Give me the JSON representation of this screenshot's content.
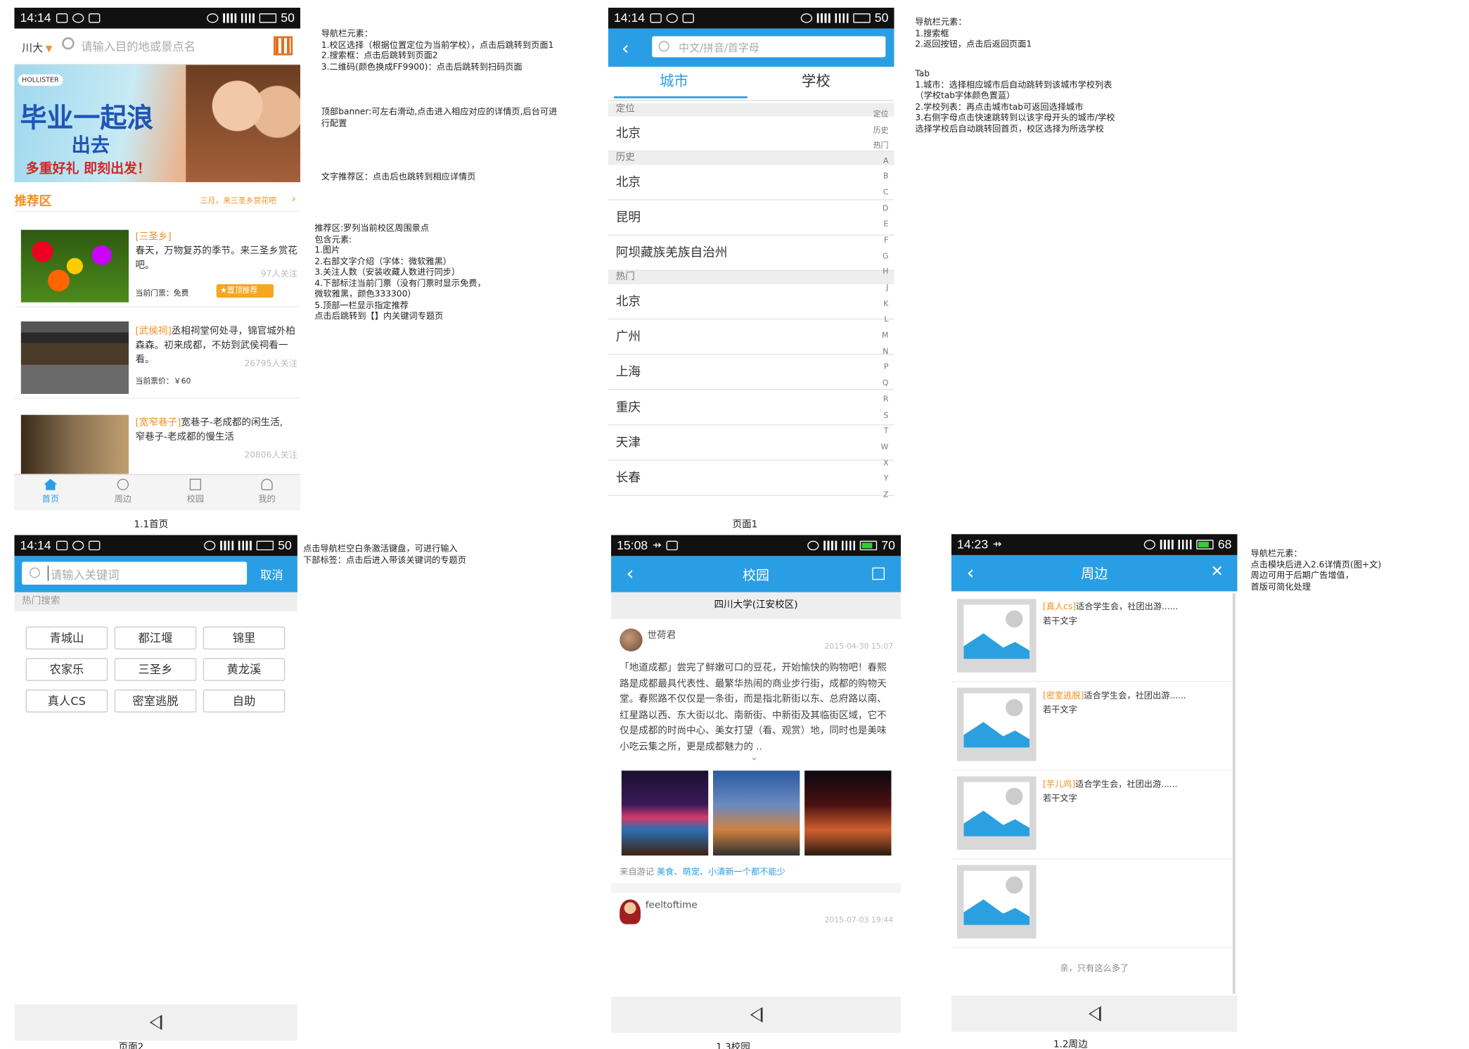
{
  "screens": {
    "home": {
      "status": {
        "time": "14:14",
        "battery": "50"
      },
      "location": "川大",
      "search_placeholder": "请输入目的地或景点名",
      "banner": {
        "brand": "HOLLISTER",
        "line1": "毕业一起浪",
        "line2": "出去",
        "line3": "多重好礼 即刻出发！"
      },
      "section_title": "推荐区",
      "section_more": "三月，来三圣乡赏花吧",
      "items": [
        {
          "tag": "[三圣乡]",
          "text": "春天，万物复苏的季节。来三圣乡赏花吧。",
          "followers": "97人关注",
          "price": "当前门票：免费",
          "badge": "置顶推荐"
        },
        {
          "tag": "[武侯祠]",
          "text": "丞相祠堂何处寻，锦官城外柏森森。初来成都，不妨到武侯祠看一看。",
          "followers": "26795人关注",
          "price": "当前票价：￥60"
        },
        {
          "tag": "[宽窄巷子]",
          "text": "宽巷子-老成都的闲生活, 窄巷子-老成都的慢生活",
          "followers": "20806人关注",
          "price": ""
        }
      ],
      "tabs": [
        "首页",
        "周边",
        "校园",
        "我的"
      ],
      "caption": "1.1首页"
    },
    "city": {
      "status": {
        "time": "14:14",
        "battery": "50"
      },
      "search_placeholder": "中文/拼音/首字母",
      "tabs": [
        "城市",
        "学校"
      ],
      "sections": [
        {
          "label": "定位",
          "rows": [
            "北京"
          ]
        },
        {
          "label": "历史",
          "rows": [
            "北京",
            "昆明",
            "阿坝藏族羌族自治州"
          ]
        },
        {
          "label": "热门",
          "rows": [
            "北京",
            "广州",
            "上海",
            "重庆",
            "天津",
            "长春"
          ]
        }
      ],
      "index": [
        "定位",
        "历史",
        "热门",
        "A",
        "B",
        "C",
        "D",
        "E",
        "F",
        "G",
        "H",
        "J",
        "K",
        "L",
        "M",
        "N",
        "P",
        "Q",
        "R",
        "S",
        "T",
        "W",
        "X",
        "Y",
        "Z"
      ],
      "caption": "页面1"
    },
    "search": {
      "status": {
        "time": "14:14",
        "battery": "50"
      },
      "placeholder": "请输入关键词",
      "cancel": "取消",
      "hot_title": "热门搜索",
      "chips": [
        "青城山",
        "都江堰",
        "锦里",
        "农家乐",
        "三圣乡",
        "黄龙溪",
        "真人CS",
        "密室逃脱",
        "自助"
      ],
      "caption": "页面2"
    },
    "campus": {
      "status": {
        "time": "15:08",
        "battery": "70"
      },
      "title": "校园",
      "school": "四川大学(江安校区)",
      "post1": {
        "user": "世荷君",
        "date": "2015-04-30 15:07",
        "body": "「地道成都」尝完了鲜嫩可口的豆花，开始愉快的购物吧！春熙路是成都最具代表性、最繁华热闹的商业步行街，成都的购物天堂。春熙路不仅仅是一条街，而是指北新街以东、总府路以南、红星路以西、东大街以北、南新街、中新街及其临街区域，它不仅是成都的时尚中心、美女打望（看、观赏）地，同时也是美味小吃云集之所，更是成都魅力的 ..",
        "source_prefix": "来自游记",
        "source_link": "美食、萌宠、小清新一个都不能少"
      },
      "post2": {
        "user": "feeltoftime",
        "date": "2015-07-03 19:44"
      },
      "caption": "1.3校园"
    },
    "nearby": {
      "status": {
        "time": "14:23",
        "battery": "68"
      },
      "title": "周边",
      "items": [
        {
          "tag": "[真人cs]",
          "text": "适合学生会，社团出游......",
          "sub": "若干文字"
        },
        {
          "tag": "[密室逃脱]",
          "text": "适合学生会，社团出游......",
          "sub": "若干文字"
        },
        {
          "tag": "[芋儿鸡]",
          "text": "适合学生会，社团出游......",
          "sub": "若干文字"
        },
        {
          "tag": "",
          "text": "",
          "sub": ""
        }
      ],
      "footer": "亲，只有这么多了",
      "caption": "1.2周边"
    }
  },
  "notes": {
    "n1": "导航栏元素：\n1.校区选择（根据位置定位为当前学校），点击后跳转到页面1\n2.搜索框：点击后跳转到页面2\n3.二维码(颜色换成FF9900)：点击后跳转到扫码页面",
    "n2": "顶部banner:可左右滑动,点击进入相应对应的详情页,后台可进行配置",
    "n3": "文字推荐区：点击后也跳转到相应详情页",
    "n4": "推荐区:罗列当前校区周围景点\n包含元素:\n1.图片\n2.右部文字介绍（字体：微软雅黑）\n3.关注人数（安装收藏人数进行同步）\n4.下部标注当前门票（没有门票时显示免费，\n微软雅黑，颜色333300）\n5.顶部一栏显示指定推荐\n点击后跳转到【】内关键词专题页",
    "n5": "导航栏元素：\n1.搜索框\n2.返回按钮，点击后返回页面1",
    "n6": "Tab\n1.城市：选择相应城市后自动跳转到该城市学校列表\n（学校tab字体颜色置蓝）\n2.学校列表：再点击城市tab可返回选择城市\n3.右侧字母点击快速跳转到以该字母开头的城市/学校\n选择学校后自动跳转回首页，校区选择为所选学校",
    "n7": "点击导航栏空白条激活键盘，可进行输入\n下部标签：点击后进入带该关键词的专题页",
    "n8": "导航栏元素：\n点击模块后进入2.6详情页(图+文)\n周边可用于后期广告增值，\n首版可简化处理"
  },
  "colors": {
    "accent": "#2a9ee4",
    "orange": "#f09020"
  }
}
